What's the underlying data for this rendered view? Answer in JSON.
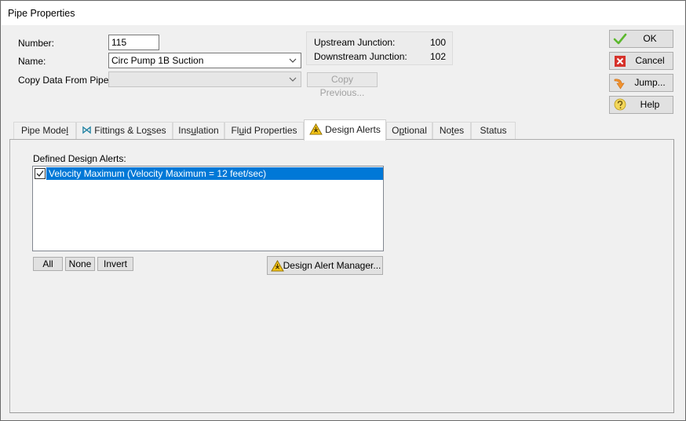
{
  "window": {
    "title": "Pipe Properties"
  },
  "fields": {
    "number_label": "Number:",
    "number_value": "115",
    "name_label": "Name:",
    "name_value": "Circ Pump 1B Suction",
    "copy_label": "Copy Data From Pipe...",
    "copy_value": "",
    "copy_previous_label": "Copy Previous..."
  },
  "junctions": {
    "upstream_label": "Upstream Junction:",
    "upstream_value": "100",
    "downstream_label": "Downstream Junction:",
    "downstream_value": "102"
  },
  "side_buttons": {
    "ok": "OK",
    "cancel": "Cancel",
    "jump": "Jump...",
    "help": "Help"
  },
  "tabs": [
    {
      "pre": "Pipe Mode",
      "u": "l",
      "post": "",
      "icon": "none"
    },
    {
      "pre": "Fittings & Lo",
      "u": "s",
      "post": "ses",
      "icon": "valve-icon"
    },
    {
      "pre": "Ins",
      "u": "u",
      "post": "lation",
      "icon": "none"
    },
    {
      "pre": "Fl",
      "u": "u",
      "post": "id Properties",
      "icon": "none"
    },
    {
      "pre": "Desi",
      "u": "g",
      "post": "n Alerts",
      "icon": "warning-icon",
      "active": true
    },
    {
      "pre": "O",
      "u": "p",
      "post": "tional",
      "icon": "none"
    },
    {
      "pre": "No",
      "u": "t",
      "post": "es",
      "icon": "none"
    },
    {
      "pre": "Status",
      "u": "",
      "post": "",
      "icon": "none"
    }
  ],
  "design_alerts": {
    "heading": "Defined Design Alerts:",
    "items": [
      {
        "label": "Velocity Maximum (Velocity Maximum = 12 feet/sec)",
        "checked": true,
        "selected": true
      }
    ],
    "buttons": {
      "all": "All",
      "none": "None",
      "invert": "Invert"
    },
    "manager_button": "Design Alert Manager..."
  },
  "colors": {
    "selection": "#0078d7",
    "ok_check": "#5cb82e",
    "cancel_red": "#d6322b",
    "warning_yellow": "#f5c518"
  }
}
